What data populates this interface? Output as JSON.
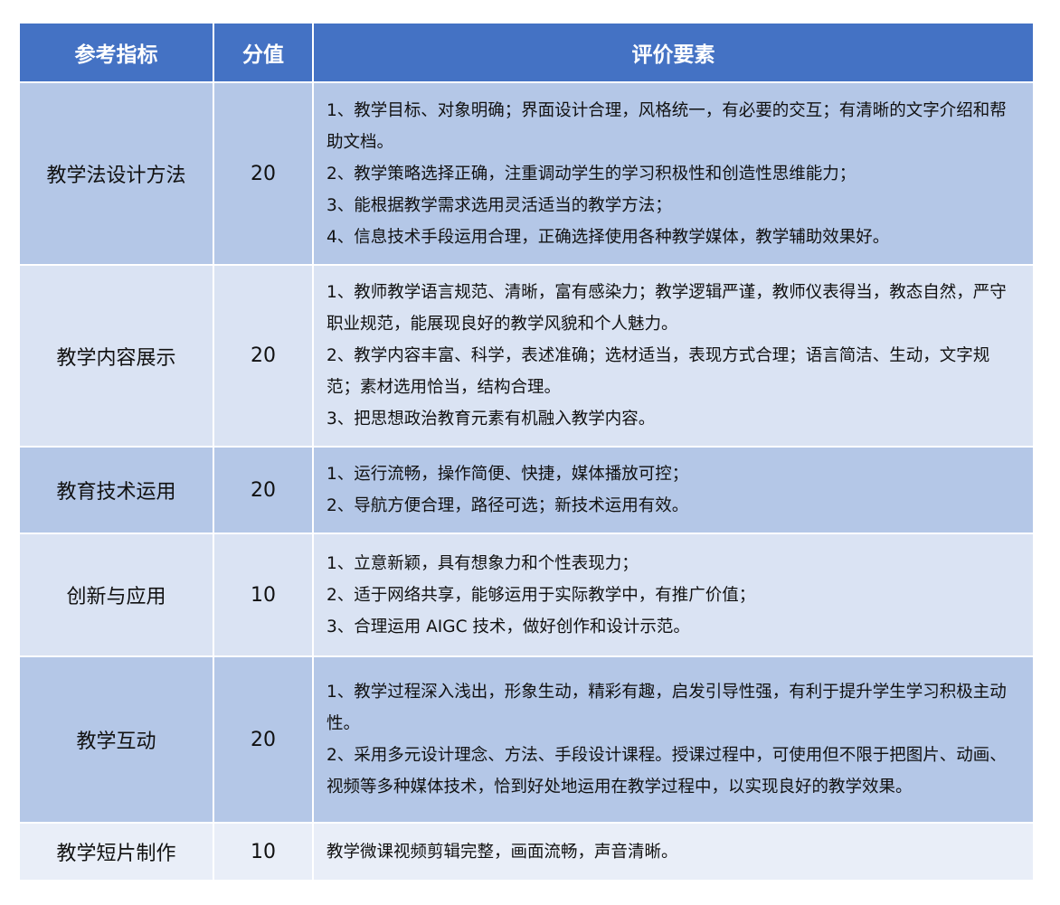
{
  "header": {
    "col1": "参考指标",
    "col2": "分值",
    "col3": "评价要素"
  },
  "rows": [
    {
      "name": "教学法设计方法",
      "score": "20",
      "lines": [
        "1、教学目标、对象明确；界面设计合理，风格统一，有必要的交互；有清晰的文字介绍和帮助文档。",
        "2、教学策略选择正确，注重调动学生的学习积极性和创造性思维能力；",
        "3、能根据教学需求选用灵活适当的教学方法；",
        "4、信息技术手段运用合理，正确选择使用各种教学媒体，教学辅助效果好。"
      ]
    },
    {
      "name": "教学内容展示",
      "score": "20",
      "lines": [
        "1、教师教学语言规范、清晰，富有感染力；教学逻辑严谨，教师仪表得当，教态自然，严守职业规范，能展现良好的教学风貌和个人魅力。",
        "2、教学内容丰富、科学，表述准确；选材适当，表现方式合理；语言简洁、生动，文字规范；素材选用恰当，结构合理。",
        "3、把思想政治教育元素有机融入教学内容。"
      ]
    },
    {
      "name": "教育技术运用",
      "score": "20",
      "lines": [
        "1、运行流畅，操作简便、快捷，媒体播放可控；",
        "2、导航方便合理，路径可选；新技术运用有效。"
      ]
    },
    {
      "name": "创新与应用",
      "score": "10",
      "lines": [
        "1、立意新颖，具有想象力和个性表现力；",
        "2、适于网络共享，能够运用于实际教学中，有推广价值；",
        "3、合理运用 AIGC 技术，做好创作和设计示范。"
      ]
    },
    {
      "name": "教学互动",
      "score": "20",
      "lines": [
        "1、教学过程深入浅出，形象生动，精彩有趣，启发引导性强，有利于提升学生学习积极主动性。",
        "2、采用多元设计理念、方法、手段设计课程。授课过程中，可使用但不限于把图片、动画、视频等多种媒体技术，恰到好处地运用在教学过程中，以实现良好的教学效果。"
      ]
    },
    {
      "name": "教学短片制作",
      "score": "10",
      "lines": [
        "教学微课视频剪辑完整，画面流畅，声音清晰。"
      ]
    }
  ],
  "colors": {
    "header_bg": "#4472c4",
    "row_dark": "#b4c7e7",
    "row_light": "#dae3f3"
  }
}
